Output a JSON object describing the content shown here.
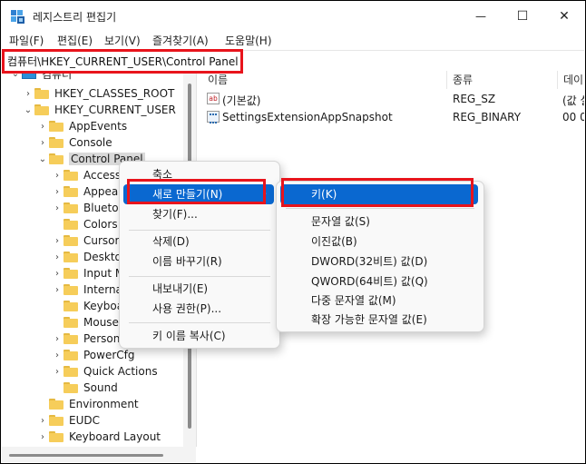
{
  "window": {
    "title": "레지스트리 편집기",
    "controls": {
      "minimize": "—",
      "maximize": "☐",
      "close": "✕"
    }
  },
  "menubar": [
    "파일(F)",
    "편집(E)",
    "보기(V)",
    "즐겨찾기(A)",
    "도움말(H)"
  ],
  "address": {
    "path": "컴퓨터\\HKEY_CURRENT_USER\\Control Panel"
  },
  "tree": {
    "root": "컴퓨터",
    "items": [
      {
        "label": "HKEY_CLASSES_ROOT",
        "depth": 1,
        "expander": "›"
      },
      {
        "label": "HKEY_CURRENT_USER",
        "depth": 1,
        "expander": "⌄"
      },
      {
        "label": "AppEvents",
        "depth": 2,
        "expander": "›"
      },
      {
        "label": "Console",
        "depth": 2,
        "expander": "›"
      },
      {
        "label": "Control Panel",
        "depth": 2,
        "expander": "⌄",
        "selected": true
      },
      {
        "label": "Access",
        "depth": 3,
        "expander": "›"
      },
      {
        "label": "Appear",
        "depth": 3,
        "expander": "›"
      },
      {
        "label": "Blueto",
        "depth": 3,
        "expander": "›"
      },
      {
        "label": "Colors",
        "depth": 3,
        "expander": ""
      },
      {
        "label": "Cursor",
        "depth": 3,
        "expander": "›"
      },
      {
        "label": "Deskto",
        "depth": 3,
        "expander": "›"
      },
      {
        "label": "Input M",
        "depth": 3,
        "expander": "›"
      },
      {
        "label": "Interna",
        "depth": 3,
        "expander": "›"
      },
      {
        "label": "Keyboa",
        "depth": 3,
        "expander": ""
      },
      {
        "label": "Mouse",
        "depth": 3,
        "expander": ""
      },
      {
        "label": "Person",
        "depth": 3,
        "expander": "›"
      },
      {
        "label": "PowerCfg",
        "depth": 3,
        "expander": "›"
      },
      {
        "label": "Quick Actions",
        "depth": 3,
        "expander": "›"
      },
      {
        "label": "Sound",
        "depth": 3,
        "expander": ""
      },
      {
        "label": "Environment",
        "depth": 2,
        "expander": ""
      },
      {
        "label": "EUDC",
        "depth": 2,
        "expander": "›"
      },
      {
        "label": "Keyboard Layout",
        "depth": 2,
        "expander": "›"
      }
    ]
  },
  "list": {
    "columns": [
      "이름",
      "종류",
      "데이"
    ],
    "rows": [
      {
        "name": "(기본값)",
        "type": "REG_SZ",
        "data": "(값 설",
        "icon": "ab"
      },
      {
        "name": "SettingsExtensionAppSnapshot",
        "type": "REG_BINARY",
        "data": "00 00",
        "icon": "binary"
      }
    ]
  },
  "context_menu": {
    "items": [
      "축소",
      "새로 만들기(N)",
      "찾기(F)...",
      "삭제(D)",
      "이름 바꾸기(R)",
      "내보내기(E)",
      "사용 권한(P)...",
      "키 이름 복사(C)"
    ],
    "highlighted": "새로 만들기(N)"
  },
  "submenu": {
    "items": [
      "키(K)",
      "문자열 값(S)",
      "이진값(B)",
      "DWORD(32비트) 값(D)",
      "QWORD(64비트) 값(Q)",
      "다중 문자열 값(M)",
      "확장 가능한 문자열 값(E)"
    ],
    "highlighted": "키(K)"
  },
  "annotation_color": "#e8141c",
  "accent_color": "#0a68d0"
}
